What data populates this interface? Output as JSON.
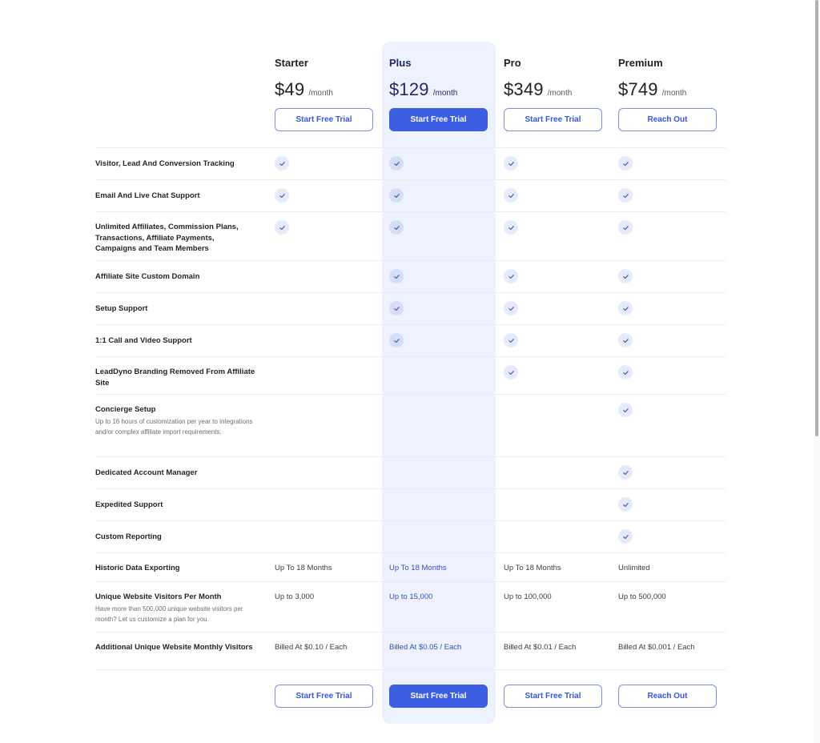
{
  "plans": [
    {
      "name": "Starter",
      "price": "$49",
      "period": "/month",
      "cta": "Start Free Trial",
      "featured": false
    },
    {
      "name": "Plus",
      "price": "$129",
      "period": "/month",
      "cta": "Start Free Trial",
      "featured": true
    },
    {
      "name": "Pro",
      "price": "$349",
      "period": "/month",
      "cta": "Start Free Trial",
      "featured": false
    },
    {
      "name": "Premium",
      "price": "$749",
      "period": "/month",
      "cta": "Reach Out",
      "featured": false
    }
  ],
  "features": [
    {
      "title": "Visitor, Lead And Conversion Tracking",
      "included": [
        true,
        true,
        true,
        true
      ]
    },
    {
      "title": "Email And Live Chat Support",
      "included": [
        true,
        true,
        true,
        true
      ]
    },
    {
      "title": "Unlimited Affiliates, Commission Plans, Transactions, Affiliate Payments, Campaigns and Team Members",
      "included": [
        true,
        true,
        true,
        true
      ]
    },
    {
      "title": "Affiliate Site Custom Domain",
      "included": [
        false,
        true,
        true,
        true
      ]
    },
    {
      "title": "Setup Support",
      "included": [
        false,
        true,
        true,
        true
      ]
    },
    {
      "title": "1:1 Call and Video Support",
      "included": [
        false,
        true,
        true,
        true
      ]
    },
    {
      "title": "LeadDyno Branding Removed From Affiliate Site",
      "included": [
        false,
        false,
        true,
        true
      ]
    },
    {
      "title": "Concierge Setup",
      "subtitle": "Up to 16 hours of customization per year to integrations and/or complex affiliate import requirements.",
      "included": [
        false,
        false,
        false,
        true
      ]
    },
    {
      "title": "Dedicated Account Manager",
      "included": [
        false,
        false,
        false,
        true
      ]
    },
    {
      "title": "Expedited Support",
      "included": [
        false,
        false,
        false,
        true
      ]
    },
    {
      "title": "Custom Reporting",
      "included": [
        false,
        false,
        false,
        true
      ]
    },
    {
      "title": "Historic Data Exporting",
      "values": [
        "Up To 18 Months",
        "Up To 18 Months",
        "Up To 18 Months",
        "Unlimited"
      ]
    },
    {
      "title": "Unique Website Visitors Per Month",
      "subtitle": "Have more than 500,000 unique website visitors per month? Let us customize a plan for you.",
      "values": [
        "Up to 3,000",
        "Up to 15,000",
        "Up to 100,000",
        "Up to 500,000"
      ]
    },
    {
      "title": "Additional Unique Website Monthly Visitors",
      "values": [
        "Billed At $0.10 / Each",
        "Billed At $0.05 / Each",
        "Billed At $0.01 / Each",
        "Billed At $0.001 / Each"
      ]
    }
  ],
  "icons": {
    "included": "check-icon"
  },
  "colors": {
    "accent": "#3b5fe0",
    "highlight_bg": "#edf2fe",
    "check_bg": "#e6ebfb",
    "check_color": "#4a5bb0"
  }
}
